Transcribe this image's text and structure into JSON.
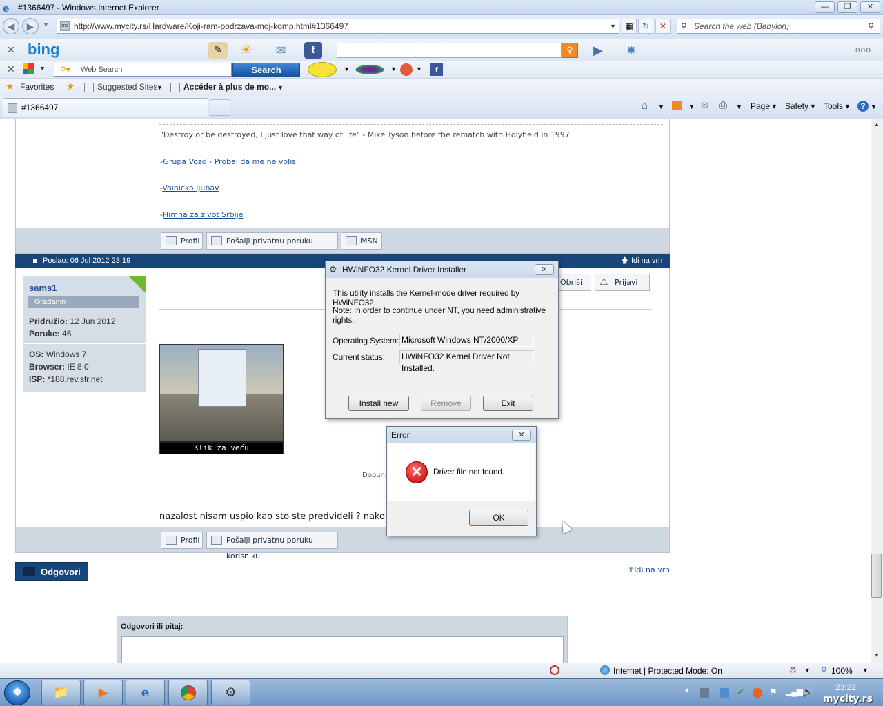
{
  "window": {
    "title": "#1366497 - Windows Internet Explorer"
  },
  "address": {
    "url": "http://www.mycity.rs/Hardware/Koji-ram-podrzava-moj-komp.html#1366497",
    "search_placeholder": "Search the web (Babylon)"
  },
  "bing_bar": {
    "logo": "bing"
  },
  "babylon_bar": {
    "web_search_placeholder": "Web Search",
    "search_button": "Search"
  },
  "favorites_bar": {
    "favorites": "Favorites",
    "suggested": "Suggested Sites",
    "acceder": "Accéder à plus de mo..."
  },
  "tab": {
    "label": "#1366497"
  },
  "commands": {
    "page": "Page",
    "safety": "Safety",
    "tools": "Tools"
  },
  "post1": {
    "quote": "\"Destroy or be destroyed, I just love that way of life\" - Mike Tyson before the rematch with Holyfield in 1997",
    "link1": "Grupa Vozd - Probaj da me ne volis",
    "link2": "Voinicka ljubav",
    "link3": "Himna za zivot Srbije",
    "dash": "-",
    "buttons": {
      "profil": "Profil",
      "pm": "Pošalji privatnu poruku korisniku",
      "msn": "MSN"
    }
  },
  "post2": {
    "posted": "Poslao: 06 Jul 2012 23:19",
    "top_link": "Idi na vrh",
    "user": {
      "name": "sams1",
      "rank": "Građanin",
      "joined_label": "Pridružio:",
      "joined": "12 Jun 2012",
      "posts_label": "Poruke:",
      "posts": "46",
      "os_label": "OS:",
      "os": "Windows 7",
      "browser_label": "Browser:",
      "browser": "IE 8.0",
      "isp_label": "ISP:",
      "isp": "*188.rev.sfr.net"
    },
    "action_delete": "Obriši",
    "action_report": "Prijavi",
    "thumb_caption": "Klik za veću",
    "edited": "Dopuna",
    "message": "nazalost nisam uspio kao sto ste predvideli ? nako",
    "buttons": {
      "profil": "Profil",
      "pm": "Pošalji privatnu poruku korisniku"
    }
  },
  "reply": {
    "button": "Odgovori",
    "top_link": "Idi na vrh",
    "panel_label": "Odgovori ili pitaj:"
  },
  "installer_dialog": {
    "title": "HWiNFO32 Kernel Driver Installer",
    "line1": "This utility installs the Kernel-mode driver required by HWiNFO32.",
    "line2": "Note: In order to continue under NT, you need administrative rights.",
    "os_label": "Operating System:",
    "os_value": "Microsoft Windows NT/2000/XP",
    "status_label": "Current status:",
    "status_value": "HWiNFO32 Kernel Driver Not Installed.",
    "install": "Install new",
    "remove": "Remove",
    "exit": "Exit"
  },
  "error_dialog": {
    "title": "Error",
    "message": "Driver file not found.",
    "ok": "OK"
  },
  "statusbar": {
    "zone": "Internet | Protected Mode: On",
    "zoom": "100%"
  },
  "taskbar": {
    "time": "23:22",
    "watermark": "mycity.rs"
  },
  "colors": {
    "forum_header": "#17467a",
    "link": "#1c4f9c",
    "error_red": "#d0021b"
  }
}
